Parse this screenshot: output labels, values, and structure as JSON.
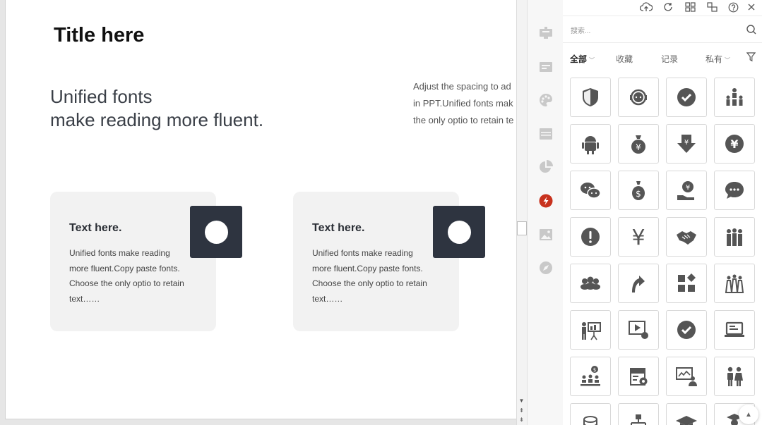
{
  "slide": {
    "title": "Title here",
    "headline_line1": "Unified fonts",
    "headline_line2": "make reading more fluent.",
    "right_text": [
      "Adjust the spacing to ad",
      "in PPT.Unified fonts mak",
      "the only optio to retain te"
    ],
    "cards": [
      {
        "title": "Text here.",
        "body": [
          "Unified fonts make reading",
          "more fluent.Copy paste fonts.",
          "Choose the only optio to retain",
          "text……"
        ]
      },
      {
        "title": "Text here.",
        "body": [
          "Unified fonts make reading",
          "more fluent.Copy paste fonts.",
          "Choose the only optio to retain",
          "text……"
        ]
      }
    ],
    "badge_color": "#2e3440"
  },
  "tool_rail": {
    "items": [
      "presentation-icon",
      "card-icon",
      "palette-icon",
      "layout-icon",
      "pie-chart-icon",
      "lightning-icon",
      "image-icon",
      "compass-icon"
    ],
    "active": "lightning-icon",
    "active_color": "#c8321e"
  },
  "panel": {
    "top_icons": [
      "cloud-upload-icon",
      "refresh-icon",
      "grid-icon",
      "shapes-icon",
      "help-icon",
      "close-icon"
    ],
    "search": {
      "placeholder": "搜索..."
    },
    "filters": {
      "all": "全部",
      "favorites": "收藏",
      "history": "记录",
      "private": "私有"
    },
    "icons": [
      "shield-icon",
      "customer-service-icon",
      "check-circle-icon",
      "team-structure-icon",
      "android-icon",
      "money-bag-yen-icon",
      "yen-arrow-down-icon",
      "yen-circle-icon",
      "wechat-icon",
      "money-bag-dollar-icon",
      "yen-hand-icon",
      "chat-bubble-icon",
      "exclamation-circle-icon",
      "yen-icon",
      "handshake-icon",
      "group-people-icon",
      "crowd-icon",
      "curved-arrow-icon",
      "dashboard-blocks-icon",
      "community-icon",
      "presenter-icon",
      "video-play-icon",
      "check-circle-icon",
      "laptop-icon",
      "dollar-team-icon",
      "store-settings-icon",
      "screen-person-icon",
      "couple-icon",
      "coin-stack-icon",
      "hierarchy-icon",
      "graduation-cap-icon",
      "graduate-icon"
    ],
    "icon_color": "#555555"
  }
}
